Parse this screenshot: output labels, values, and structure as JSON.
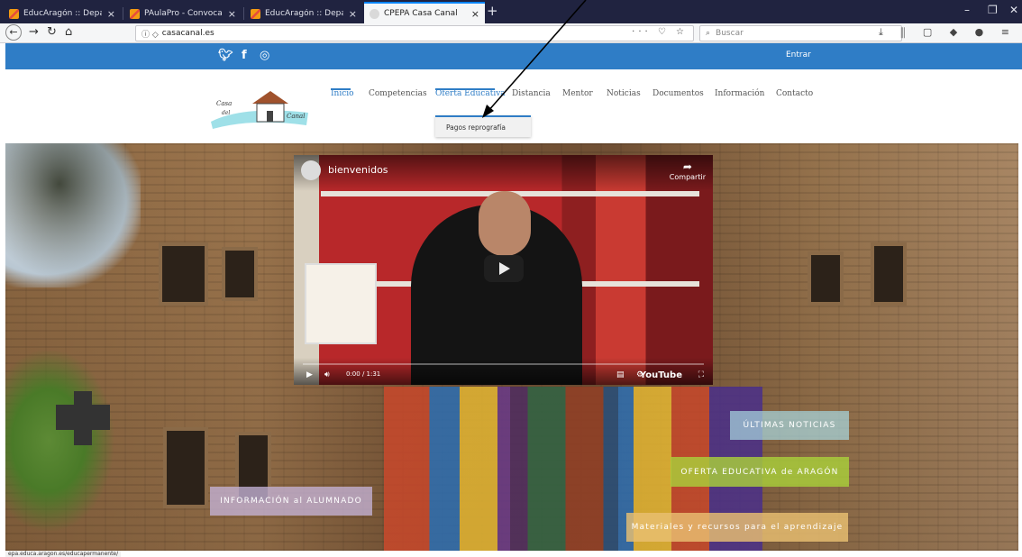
{
  "browser": {
    "tabs": [
      {
        "title": "EducAragón :: Departamento d",
        "active": false
      },
      {
        "title": "PAulaPro - Convocatorias de p",
        "active": false
      },
      {
        "title": "EducAragón :: Departamento d",
        "active": false
      },
      {
        "title": "CPEPA Casa Canal",
        "active": true
      }
    ],
    "url": "casacanal.es",
    "search_placeholder": "Buscar",
    "status_url": "epa.educa.aragon.es/educapermanente/"
  },
  "site": {
    "entrar": "Entrar",
    "logo_text": [
      "Casa",
      "del",
      "Canal"
    ],
    "nav": [
      {
        "label": "Inicio"
      },
      {
        "label": "Competencias"
      },
      {
        "label": "Oferta Educativa"
      },
      {
        "label": "Distancia"
      },
      {
        "label": "Mentor"
      },
      {
        "label": "Noticias"
      },
      {
        "label": "Documentos"
      },
      {
        "label": "Información"
      },
      {
        "label": "Contacto"
      }
    ],
    "dropdown": {
      "item": "Pagos reprografía"
    },
    "video": {
      "title": "bienvenidos",
      "share": "Compartir",
      "time": "0:00 / 1:31",
      "brand": "YouTube"
    },
    "buttons": {
      "noticias": "ÚLTIMAS NOTICIAS",
      "oferta": "OFERTA EDUCATIVA de ARAGÓN",
      "alumnado": "INFORMACIÓN al ALUMNADO",
      "materiales": "Materiales y recursos para el aprendizaje"
    },
    "colors": {
      "primary": "#2f7dc6",
      "nav_text": "#555555"
    }
  }
}
